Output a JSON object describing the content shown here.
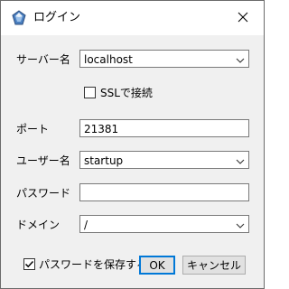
{
  "window": {
    "title": "ログイン",
    "icon": "app-gem-icon",
    "close_icon": "close-icon"
  },
  "form": {
    "server_label": "サーバー名",
    "server_value": "localhost",
    "ssl_label": "SSLで接続",
    "ssl_checked": false,
    "port_label": "ポート",
    "port_value": "21381",
    "user_label": "ユーザー名",
    "user_value": "startup",
    "password_label": "パスワード",
    "password_value": "",
    "domain_label": "ドメイン",
    "domain_value": "/"
  },
  "footer": {
    "save_password_label": "パスワードを保存する",
    "save_password_checked": true,
    "ok_label": "OK",
    "cancel_label": "キャンセル"
  },
  "colors": {
    "dialog_bg": "#f0f0f0",
    "titlebar_bg": "#ffffff",
    "default_button_border": "#0078d7"
  }
}
